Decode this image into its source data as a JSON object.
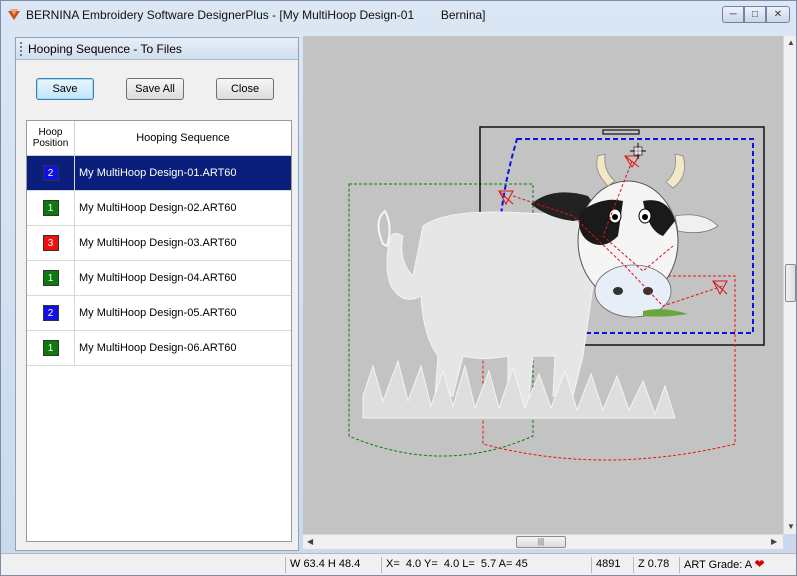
{
  "window": {
    "title": "BERNINA Embroidery Software DesignerPlus - [My MultiHoop Design-01        Bernina]",
    "controls": [
      "minimize-icon",
      "restore-icon",
      "close-icon"
    ]
  },
  "panel": {
    "title": "Hooping Sequence - To Files",
    "buttons": {
      "save": "Save",
      "save_all": "Save All",
      "close": "Close"
    },
    "columns": {
      "position": "Hoop Position",
      "sequence": "Hooping Sequence"
    },
    "rows": [
      {
        "position": "2",
        "color": "#1010e0",
        "name": "My MultiHoop Design-01.ART60",
        "selected": true
      },
      {
        "position": "1",
        "color": "#0e7a0e",
        "name": "My MultiHoop Design-02.ART60",
        "selected": false
      },
      {
        "position": "3",
        "color": "#f01010",
        "name": "My MultiHoop Design-03.ART60",
        "selected": false
      },
      {
        "position": "1",
        "color": "#0e7a0e",
        "name": "My MultiHoop Design-04.ART60",
        "selected": false
      },
      {
        "position": "2",
        "color": "#1010e0",
        "name": "My MultiHoop Design-05.ART60",
        "selected": false
      },
      {
        "position": "1",
        "color": "#0e7a0e",
        "name": "My MultiHoop Design-06.ART60",
        "selected": false
      }
    ]
  },
  "canvas": {
    "hoop_colors": {
      "hoop1": "#0e7a0e",
      "hoop2": "#1010e0",
      "hoop3": "#f01010"
    },
    "background": "#c3c3c3"
  },
  "status": {
    "size": "W 63.4 H 48.4",
    "coords": "X=  4.0 Y=  4.0 L=  5.7 A= 45",
    "stitches": "4891",
    "zoom": "Z 0.78",
    "grade": "ART Grade: A"
  }
}
